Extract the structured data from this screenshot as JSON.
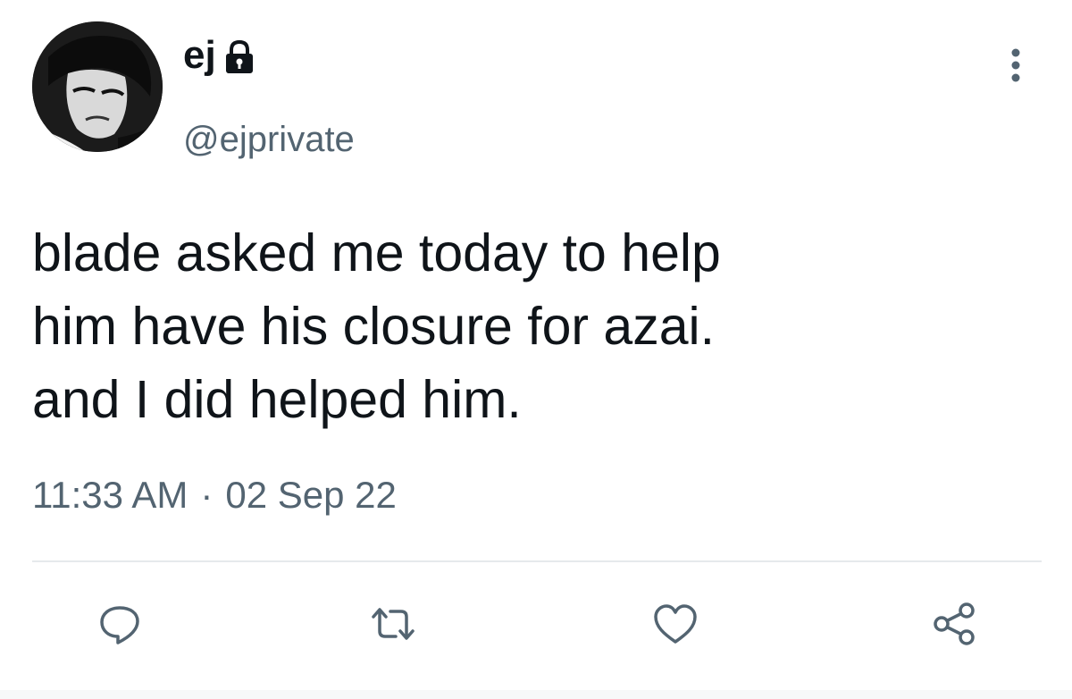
{
  "author": {
    "display_name": "ej",
    "handle": "@ejprivate",
    "avatar_icon": "profile-avatar",
    "protected_icon": "lock-icon"
  },
  "tweet": {
    "text": "blade asked me today to help\nhim have his closure for azai.\nand I did helped him.",
    "time": "11:33 AM",
    "separator": "·",
    "date": "02 Sep 22"
  },
  "actions": {
    "reply_icon": "reply-icon",
    "retweet_icon": "retweet-icon",
    "like_icon": "heart-icon",
    "share_icon": "share-icon",
    "more_icon": "more-vertical-icon"
  },
  "colors": {
    "text": "#0f1419",
    "secondary": "#536471",
    "divider": "#e6e9ec"
  }
}
